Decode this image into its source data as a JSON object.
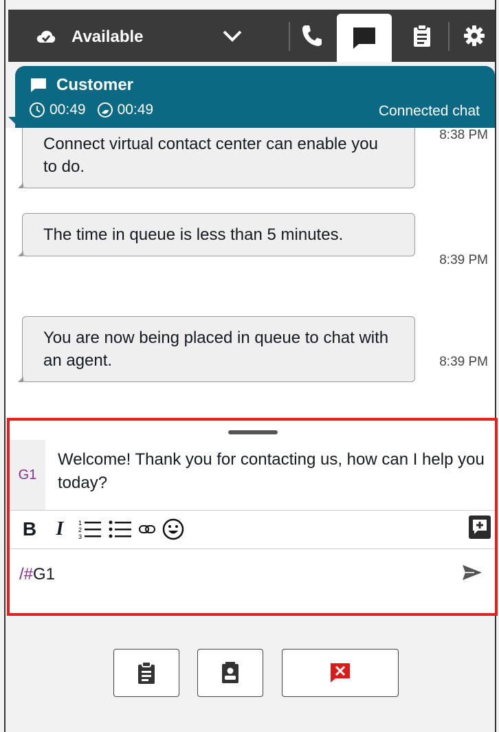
{
  "header": {
    "status_label": "Available",
    "status_icon": "cloud-available-icon",
    "tabs": [
      "phone-icon",
      "chat-icon",
      "task-icon",
      "gear-icon"
    ],
    "active_tab": "chat-icon"
  },
  "contact": {
    "name": "Customer",
    "timer_1": "00:49",
    "timer_2": "00:49",
    "state": "Connected chat",
    "accent": "#0c6984"
  },
  "messages": [
    {
      "text": "Connect virtual contact center can enable you to do.",
      "time": "8:38 PM"
    },
    {
      "text": "The time in queue is less than 5 minutes.",
      "time": "8:39 PM"
    },
    {
      "text": "You are now being placed in queue to chat with an agent.",
      "time": "8:39 PM"
    }
  ],
  "composer": {
    "suggestion_tag": "G1",
    "suggestion_text": "Welcome! Thank you for contacting us, how can I help you today?",
    "input_prefix": "/#",
    "input_value": "G1",
    "highlight_color": "#e0201c"
  },
  "toolbar": {
    "bold_label": "B",
    "italic_label": "I"
  }
}
